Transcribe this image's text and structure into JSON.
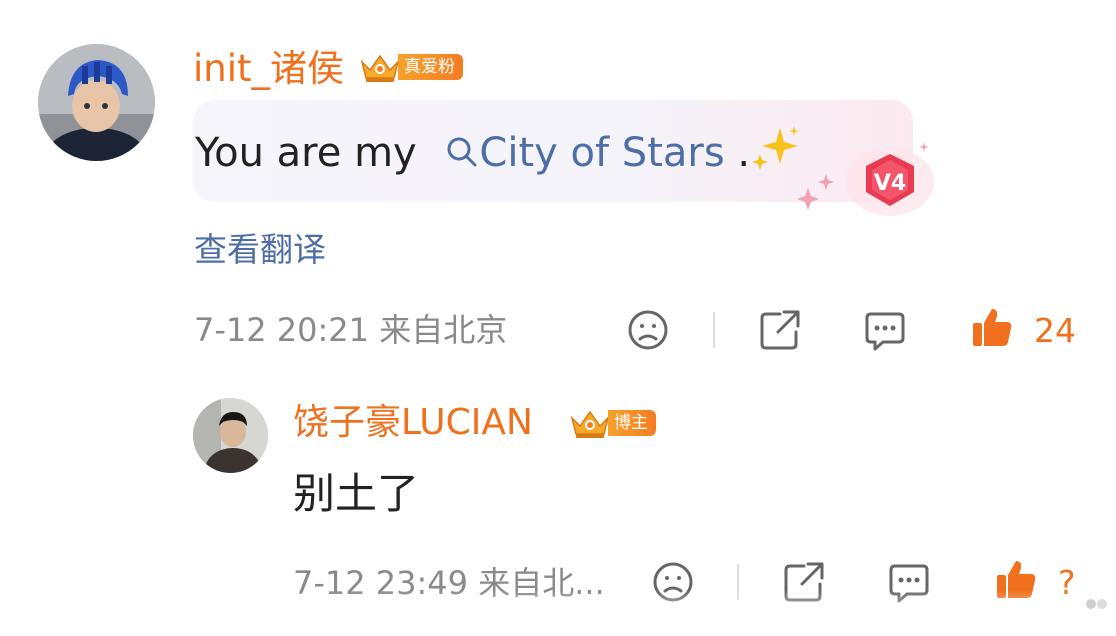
{
  "comment": {
    "username": "init_诸侯",
    "fan_badge_label": "真爱粉",
    "text_before_link": "You are my ",
    "topic_link": "City of Stars",
    "text_after_link": " .",
    "sparkle_emoji": "✨",
    "vip_badge_label": "V4",
    "translate_label": "查看翻译",
    "meta": "7-12 20:21 来自北京",
    "like_count": "24"
  },
  "reply": {
    "username": "饶子豪LUCIAN",
    "role_badge_label": "博主",
    "text": "别土了",
    "meta": "7-12 23:49 来自北...",
    "like_count": "?"
  },
  "colors": {
    "username": "#f0701e",
    "link": "#4e6ea6",
    "meta_text": "#8a8a8a",
    "badge_orange": "#f47d22",
    "vip_red": "#e83a50"
  },
  "icons": {
    "dislike": "frown-face-icon",
    "share": "share-icon",
    "comment": "comment-bubble-icon",
    "like": "thumbs-up-icon",
    "search": "search-icon"
  }
}
